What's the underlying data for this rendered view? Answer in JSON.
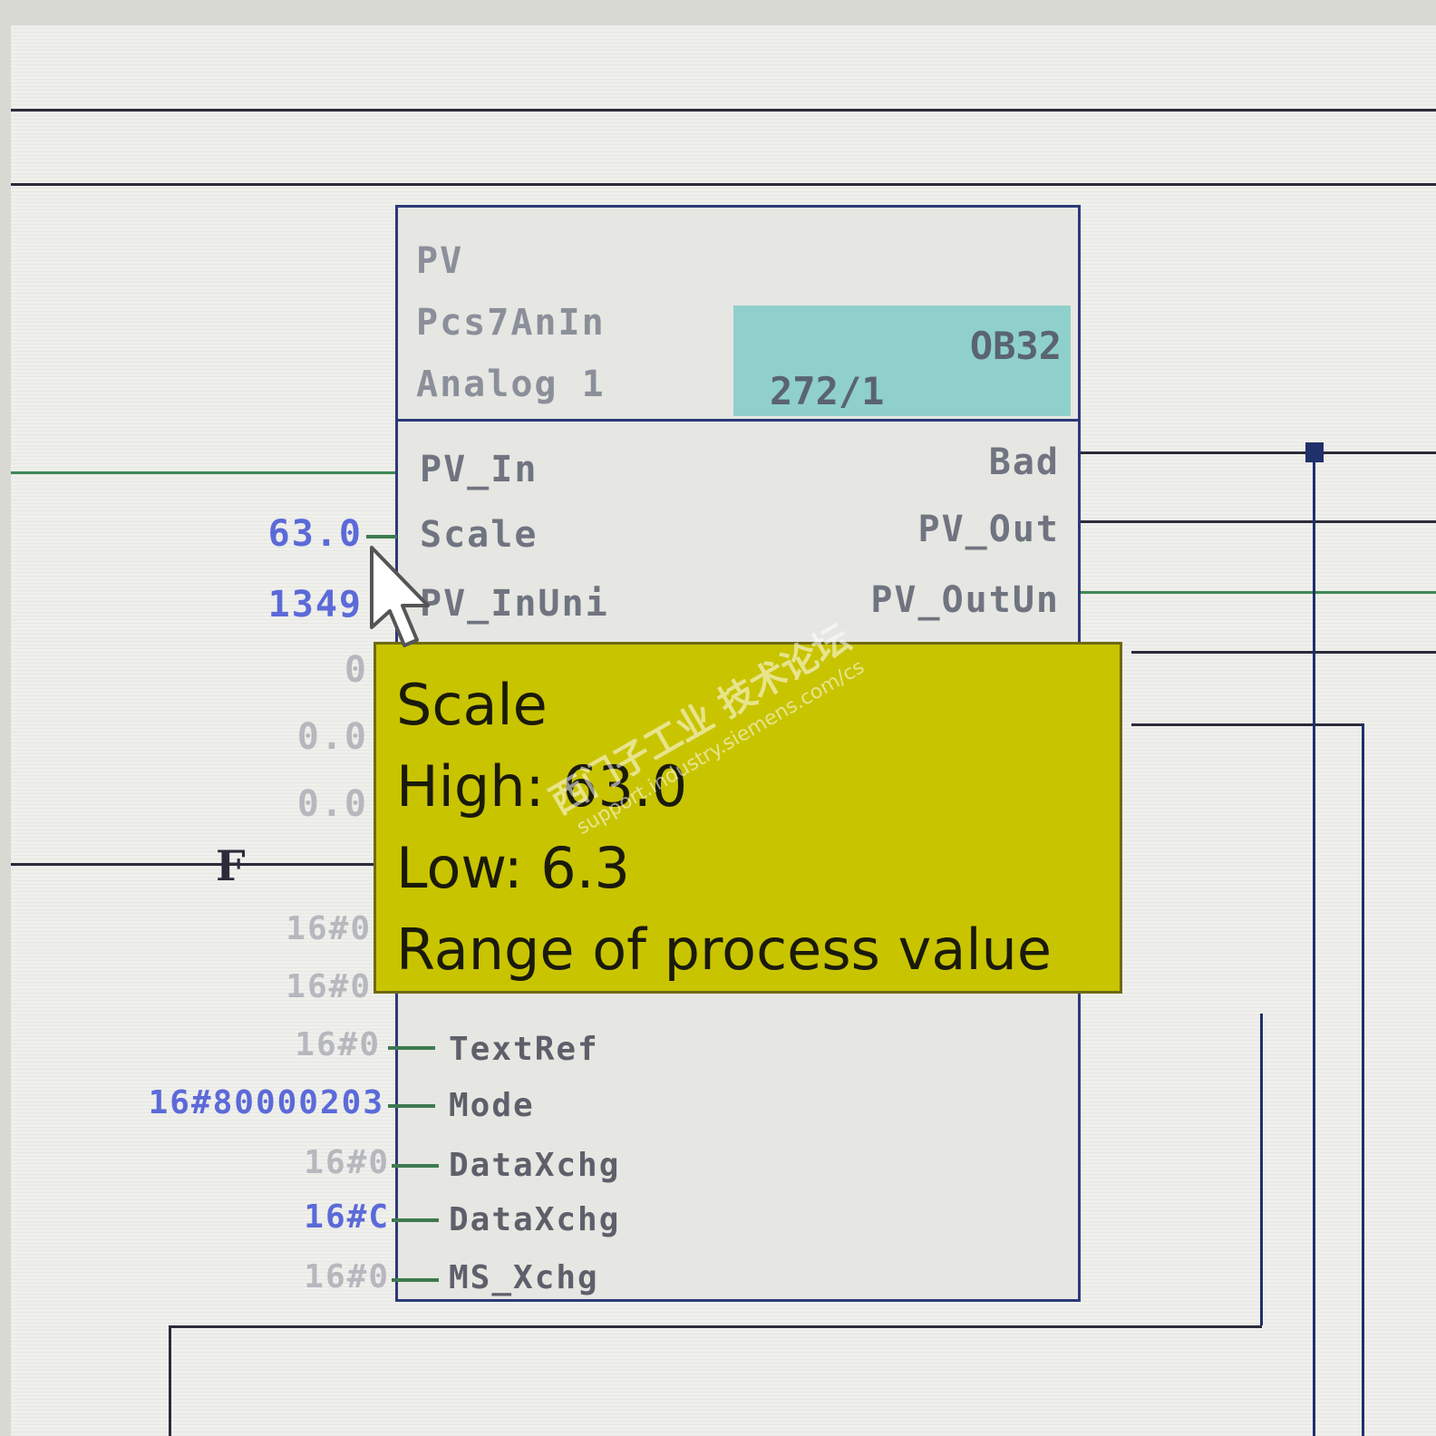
{
  "block": {
    "name": "PV",
    "type": "Pcs7AnIn",
    "comment": "Analog 1",
    "task": "OB32",
    "run_sequence": "272/1",
    "inputs": [
      {
        "label": "PV_In",
        "value": ""
      },
      {
        "label": "Scale",
        "value": "63.0"
      },
      {
        "label": "PV_InUni",
        "value": "1349"
      },
      {
        "label": "",
        "value": "0"
      },
      {
        "label": "",
        "value": "0.0"
      },
      {
        "label": "",
        "value": "0.0"
      }
    ],
    "lower_inputs": [
      {
        "label": "",
        "value": "16#0"
      },
      {
        "label": "",
        "value": "16#0"
      },
      {
        "label": "TextRef",
        "value": "16#0"
      },
      {
        "label": "Mode",
        "value": "16#80000203"
      },
      {
        "label": "DataXchg",
        "value": "16#0"
      },
      {
        "label": "DataXchg",
        "value": "16#C"
      },
      {
        "label": "MS_Xchg",
        "value": "16#0"
      }
    ],
    "outputs": [
      "Bad",
      "PV_Out",
      "PV_OutUn"
    ]
  },
  "tooltip": {
    "title": "Scale",
    "high": "High: 63.0",
    "low": "Low: 6.3",
    "description": "Range of process value"
  },
  "watermark": {
    "text": "西门子工业 技术论坛",
    "url": "support.industry.siemens.com/cs"
  },
  "marker": "F",
  "colors": {
    "tooltip_bg": "#c9c400",
    "info_box": "#8fd0cc",
    "value_blue": "#5b6ad8",
    "block_border": "#2c3a78"
  }
}
